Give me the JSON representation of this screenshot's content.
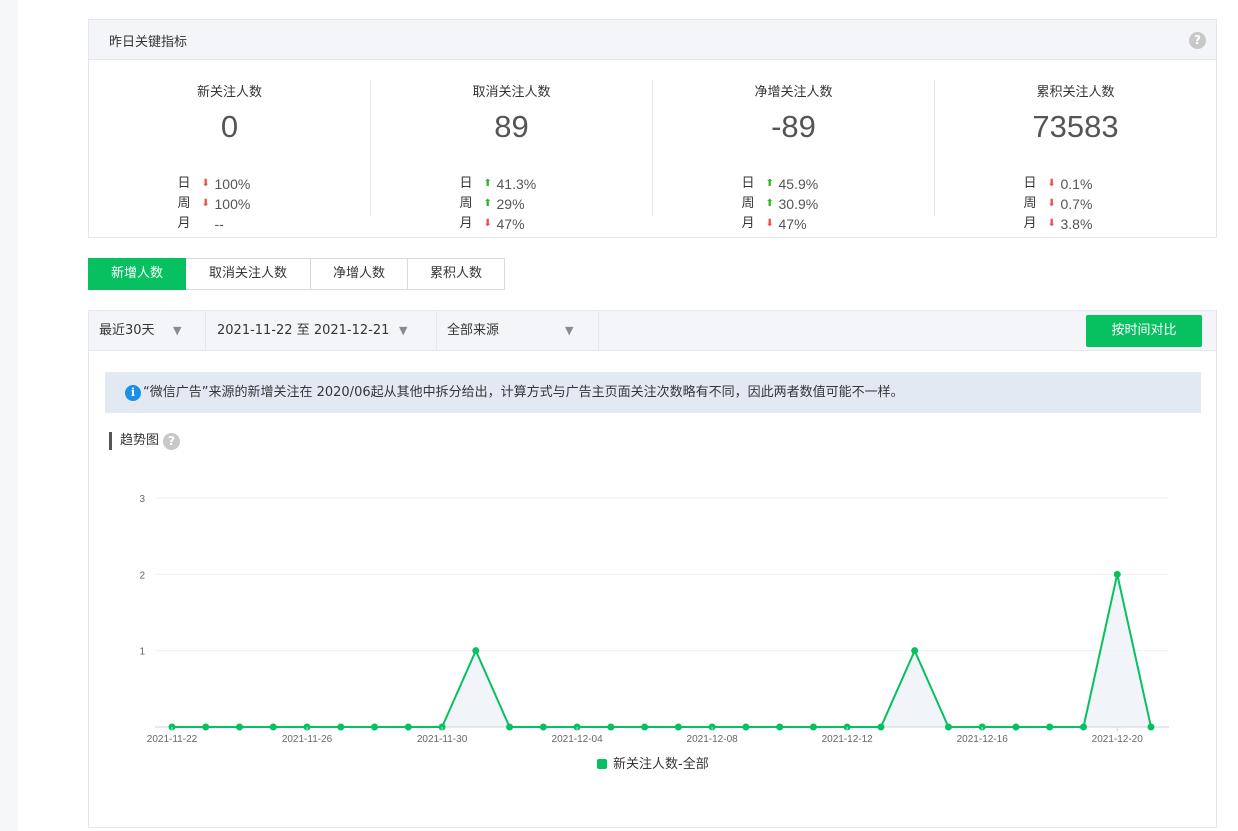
{
  "metrics": {
    "title": "昨日关键指标",
    "help": "?",
    "period_labels": [
      "日",
      "周",
      "月"
    ],
    "items": [
      {
        "label": "新关注人数",
        "value": "0",
        "changes": [
          {
            "dir": "down",
            "pct": "100%"
          },
          {
            "dir": "down",
            "pct": "100%"
          },
          {
            "dir": "none",
            "pct": "--"
          }
        ]
      },
      {
        "label": "取消关注人数",
        "value": "89",
        "changes": [
          {
            "dir": "up",
            "pct": "41.3%"
          },
          {
            "dir": "up",
            "pct": "29%"
          },
          {
            "dir": "down",
            "pct": "47%"
          }
        ]
      },
      {
        "label": "净增关注人数",
        "value": "-89",
        "changes": [
          {
            "dir": "up",
            "pct": "45.9%"
          },
          {
            "dir": "up",
            "pct": "30.9%"
          },
          {
            "dir": "down",
            "pct": "47%"
          }
        ]
      },
      {
        "label": "累积关注人数",
        "value": "73583",
        "changes": [
          {
            "dir": "down",
            "pct": "0.1%"
          },
          {
            "dir": "down",
            "pct": "0.7%"
          },
          {
            "dir": "down",
            "pct": "3.8%"
          }
        ]
      }
    ]
  },
  "tabs": [
    {
      "label": "新增人数",
      "active": true
    },
    {
      "label": "取消关注人数",
      "active": false
    },
    {
      "label": "净增人数",
      "active": false
    },
    {
      "label": "累积人数",
      "active": false
    }
  ],
  "filters": {
    "range": "最近30天",
    "dates": "2021-11-22 至 2021-12-21",
    "source": "全部来源",
    "compare_button": "按时间对比"
  },
  "notice": {
    "icon": "i",
    "text": "“微信广告”来源的新增关注在 2020/06起从其他中拆分给出，计算方式与广告主页面关注次数略有不同，因此两者数值可能不一样。"
  },
  "trend": {
    "title": "趋势图",
    "help": "?"
  },
  "colors": {
    "accent": "#07c160",
    "down": "#e84f4f",
    "up": "#3aae2e",
    "notice_bg": "#e2e9f3"
  },
  "chart_data": {
    "type": "line",
    "x": [
      "2021-11-22",
      "2021-11-23",
      "2021-11-24",
      "2021-11-25",
      "2021-11-26",
      "2021-11-27",
      "2021-11-28",
      "2021-11-29",
      "2021-11-30",
      "2021-12-01",
      "2021-12-02",
      "2021-12-03",
      "2021-12-04",
      "2021-12-05",
      "2021-12-06",
      "2021-12-07",
      "2021-12-08",
      "2021-12-09",
      "2021-12-10",
      "2021-12-11",
      "2021-12-12",
      "2021-12-13",
      "2021-12-14",
      "2021-12-15",
      "2021-12-16",
      "2021-12-17",
      "2021-12-18",
      "2021-12-19",
      "2021-12-20",
      "2021-12-21"
    ],
    "x_tick_labels": [
      "2021-11-22",
      "2021-11-26",
      "2021-11-30",
      "2021-12-04",
      "2021-12-08",
      "2021-12-12",
      "2021-12-16",
      "2021-12-20"
    ],
    "series": [
      {
        "name": "新关注人数-全部",
        "values": [
          0,
          0,
          0,
          0,
          0,
          0,
          0,
          0,
          0,
          1,
          0,
          0,
          0,
          0,
          0,
          0,
          0,
          0,
          0,
          0,
          0,
          0,
          1,
          0,
          0,
          0,
          0,
          0,
          2,
          0
        ]
      }
    ],
    "y_ticks": [
      "1",
      "2",
      "3"
    ],
    "ylim": [
      0,
      3
    ],
    "grid": true,
    "legend": "bottom"
  }
}
